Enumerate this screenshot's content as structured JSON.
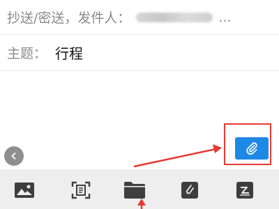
{
  "header": {
    "cc_label": "抄送/密送，发件人：",
    "ellipsis": "..."
  },
  "subject": {
    "label": "主题：",
    "value": "行程"
  },
  "compose": {
    "collapse_icon": "chevron-left-icon",
    "attach_icon": "paperclip-icon",
    "accent_color": "#1e88e5"
  },
  "toolbar": {
    "items": [
      {
        "icon": "image-icon"
      },
      {
        "icon": "scan-document-icon"
      },
      {
        "icon": "folder-icon"
      },
      {
        "icon": "doodle-icon"
      },
      {
        "icon": "signature-icon"
      }
    ]
  },
  "annotation": {
    "color": "#e53935"
  }
}
